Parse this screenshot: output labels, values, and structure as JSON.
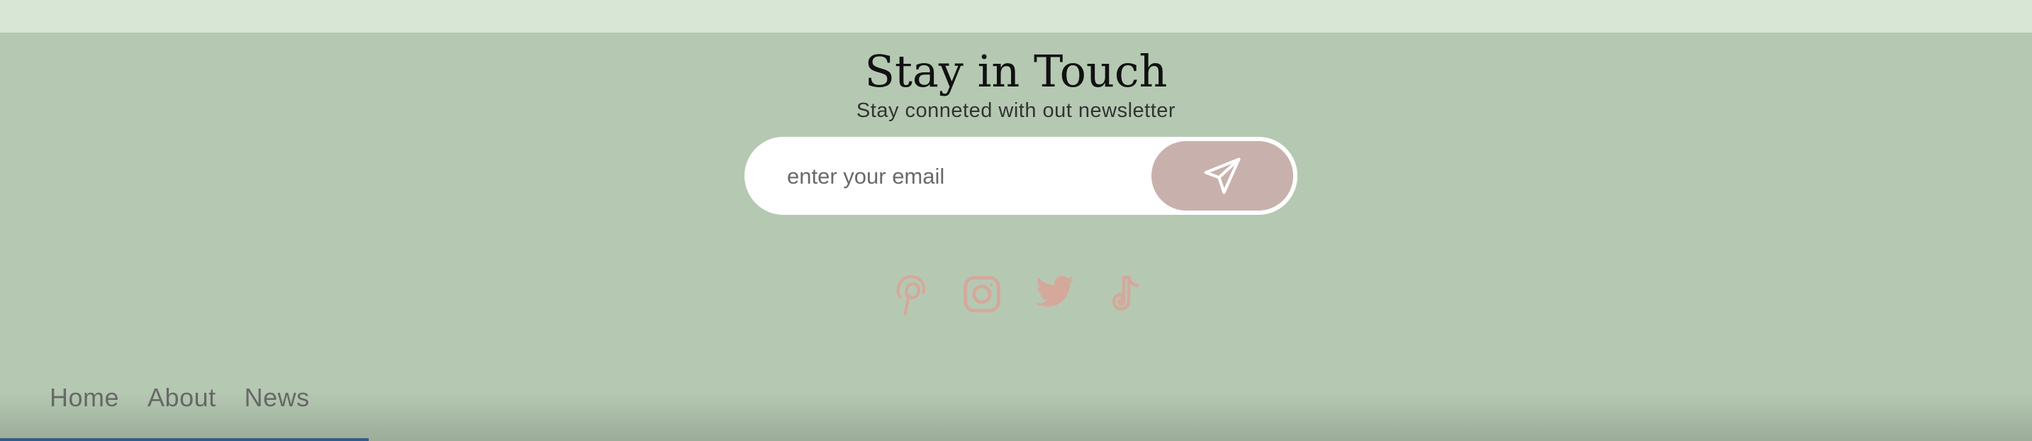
{
  "newsletter": {
    "title": "Stay in Touch",
    "subtitle": "Stay conneted with out newsletter",
    "email_placeholder": "enter your email",
    "send_icon": "paper-plane-icon"
  },
  "social": {
    "items": [
      {
        "name": "pinterest-icon"
      },
      {
        "name": "instagram-icon"
      },
      {
        "name": "twitter-icon"
      },
      {
        "name": "tiktok-icon"
      }
    ],
    "color": "#d4a99c"
  },
  "nav": {
    "items": [
      {
        "label": "Home"
      },
      {
        "label": "About"
      },
      {
        "label": "News"
      }
    ]
  },
  "colors": {
    "background": "#b5c9b2",
    "top_strip": "#d8e6d5",
    "button": "#c8b1ad"
  }
}
